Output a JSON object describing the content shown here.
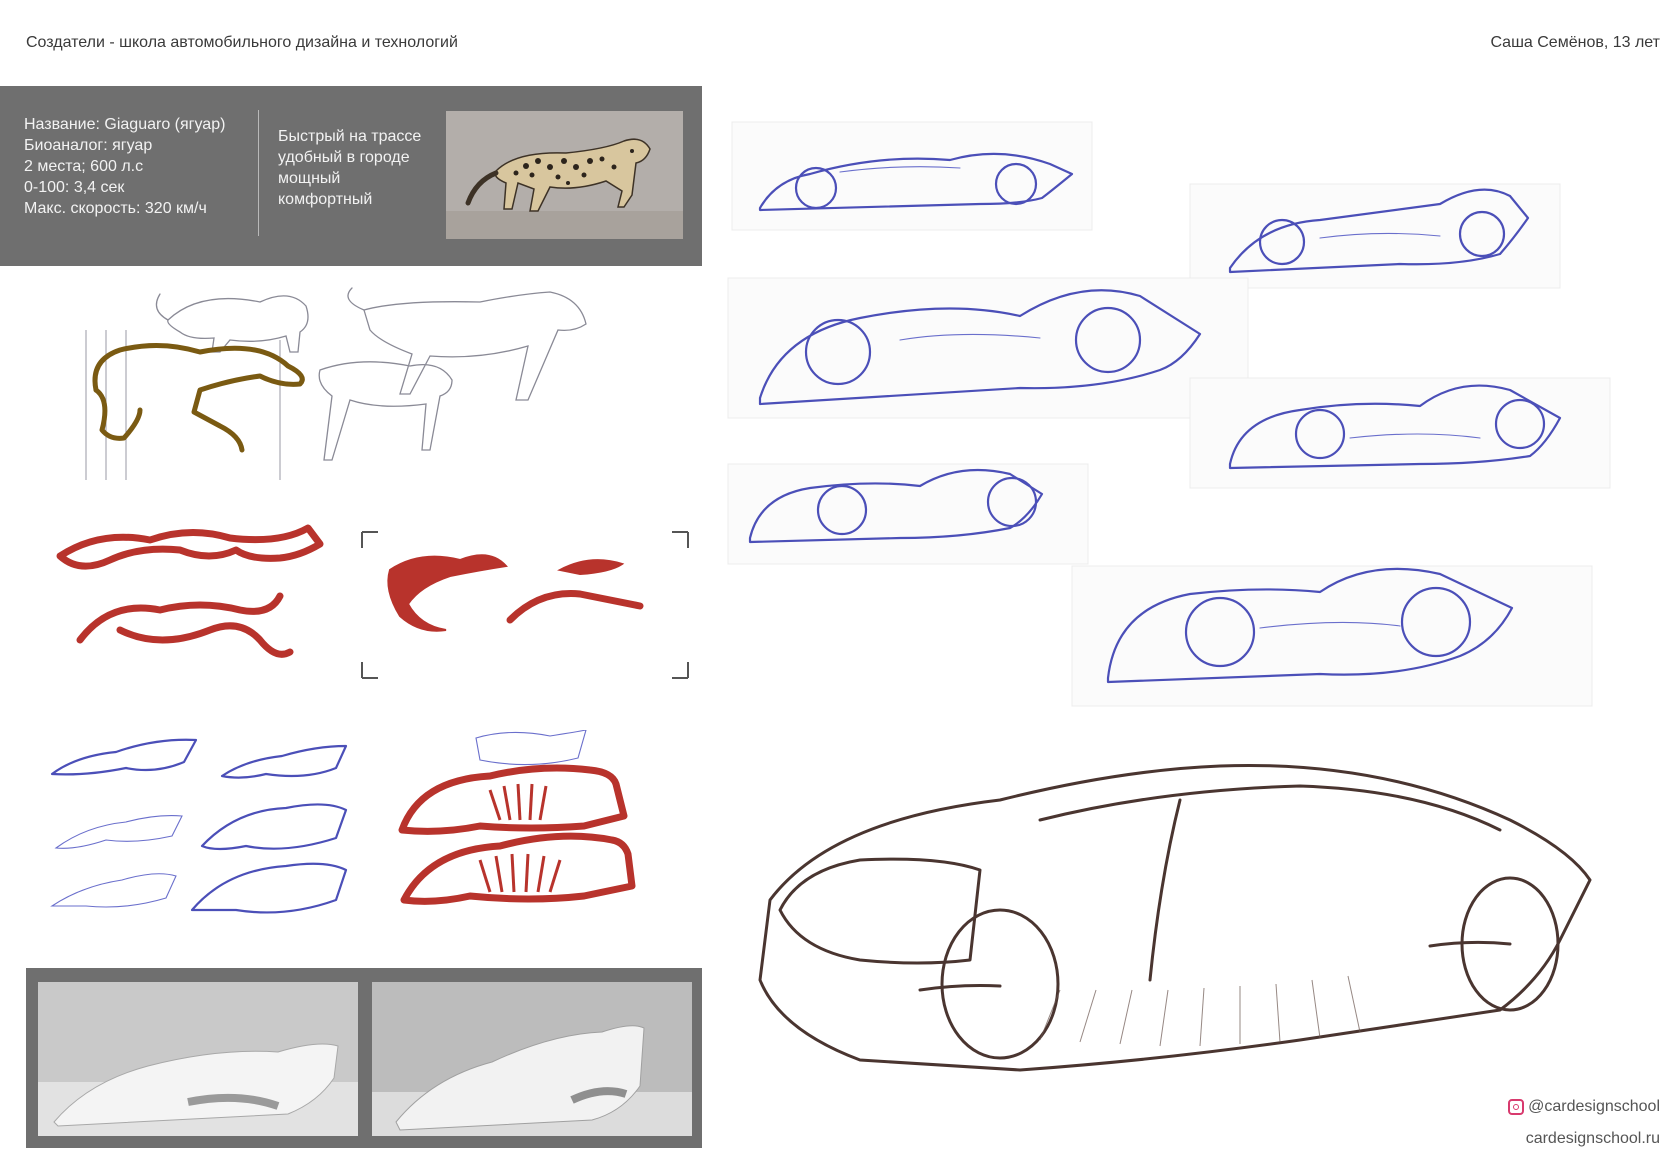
{
  "header": {
    "school": "Создатели - школа автомобильного дизайна и технологий",
    "author": "Саша Семёнов, 13 лет"
  },
  "specs": {
    "lines": [
      "Название: Giaguaro (ягуар)",
      "Биоаналог: ягуар",
      "2 места; 600 л.с",
      "0-100: 3,4 сек",
      "Макс. скорость: 320 км/ч"
    ],
    "description": [
      "Быстрый на трассе",
      "удобный в городе",
      "мощный",
      "комфортный"
    ]
  },
  "footer": {
    "instagram": "@cardesignschool",
    "website": "cardesignschool.ru"
  },
  "colors": {
    "panel_gray": "#6f6f6f",
    "ink_blue": "#4b4fb8",
    "marker_red": "#b8332c",
    "pencil_brown": "#4a3530"
  },
  "icons": {
    "social": "instagram-icon"
  }
}
